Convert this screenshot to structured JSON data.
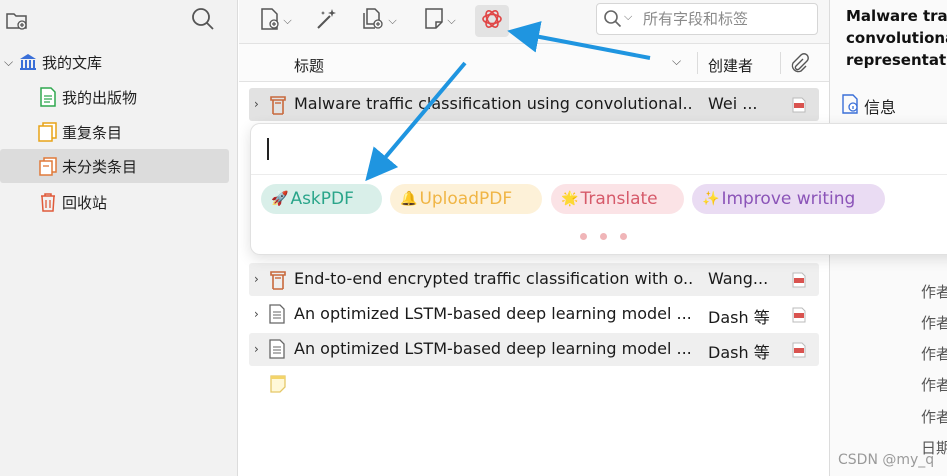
{
  "sidebar": {
    "new_collection_icon": "folder-plus-icon",
    "search_icon": "search-icon",
    "library": {
      "label": "我的文库",
      "expanded": true
    },
    "items": [
      {
        "label": "我的出版物",
        "icon": "document-icon",
        "color": "#2fa84f"
      },
      {
        "label": "重复条目",
        "icon": "duplicate-icon",
        "color": "#e8a317"
      },
      {
        "label": "未分类条目",
        "icon": "unfiled-icon",
        "color": "#e07a3a",
        "selected": true
      },
      {
        "label": "回收站",
        "icon": "trash-icon",
        "color": "#e05a3a"
      }
    ]
  },
  "toolbar": {
    "search_placeholder": "所有字段和标签",
    "buttons": [
      "new-item-icon",
      "magic-wand-icon",
      "add-attachment-icon",
      "new-note-icon",
      "chatgpt-icon"
    ]
  },
  "columns": {
    "title": "标题",
    "creator": "创建者",
    "attachments_icon": "paperclip-icon"
  },
  "rows": [
    {
      "title": "Malware traffic classification using convolutional...",
      "author": "Wei ...",
      "type": "book-section",
      "pdf": true
    },
    {
      "title": "End-to-end encrypted traffic classification with o...",
      "author": "Wang...",
      "type": "book-section",
      "pdf": true
    },
    {
      "title": "An optimized LSTM-based deep learning model ...",
      "author": "Dash 等",
      "type": "document",
      "pdf": true
    },
    {
      "title": "An optimized LSTM-based deep learning model ...",
      "author": "Dash 等",
      "type": "document",
      "pdf": true
    },
    {
      "title": "",
      "author": "",
      "type": "note",
      "pdf": false
    }
  ],
  "popup": {
    "input_value": "",
    "chips": [
      {
        "label": "AskPDF",
        "emoji": "🚀",
        "bg": "#d9efe9",
        "fg": "#2aa58a"
      },
      {
        "label": "UploadPDF",
        "emoji": "🔔",
        "bg": "#fdf1d8",
        "fg": "#f0b545"
      },
      {
        "label": "Translate",
        "emoji": "🌟",
        "bg": "#fbe3e6",
        "fg": "#d65a6a"
      },
      {
        "label": "Improve writing",
        "emoji": "✨",
        "bg": "#eadcf3",
        "fg": "#8b54b8"
      }
    ]
  },
  "right_pane": {
    "title_lines": [
      "Malware traf",
      "convolutiona",
      "representatio"
    ],
    "info_tab": "信息",
    "meta_labels": [
      "作者",
      "作者",
      "作者",
      "作者",
      "作者",
      "日期"
    ]
  },
  "watermark": "CSDN @my_q",
  "colors": {
    "accent_arrow": "#1f95e0",
    "chatgpt_red": "#e04646"
  }
}
